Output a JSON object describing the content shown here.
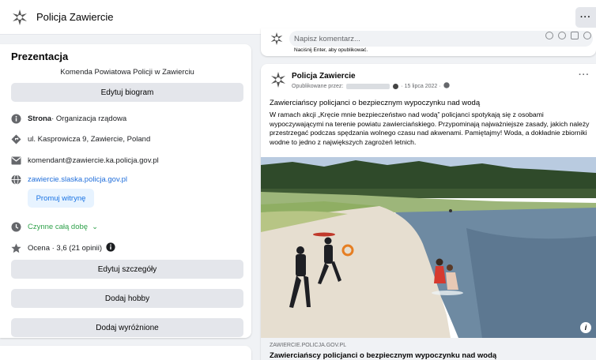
{
  "page": {
    "name": "Policja Zawiercie",
    "more_label": "···"
  },
  "intro": {
    "title": "Prezentacja",
    "bio": "Komenda Powiatowa Policji w Zawierciu",
    "edit_bio_label": "Edytuj biogram",
    "category_prefix": "Strona",
    "category": " · Organizacja rządowa",
    "address": "ul. Kasprowicza 9, Zawiercie, Poland",
    "email": "komendant@zawiercie.ka.policja.gov.pl",
    "website": "zawiercie.slaska.policja.gov.pl",
    "promote_label": "Promuj witrynę",
    "hours": "Czynne całą dobę",
    "hours_chevron": "⌄",
    "rating": "Ocena · 3,6 (21 opinii)",
    "edit_details_label": "Edytuj szczegóły",
    "add_hobby_label": "Dodaj hobby",
    "add_featured_label": "Dodaj wyróżnione"
  },
  "comment": {
    "placeholder": "Napisz komentarz...",
    "hint": "Naciśnij Enter, aby opublikować."
  },
  "post": {
    "author": "Policja Zawiercie",
    "published_by": "Opublikowane przez:",
    "date": "· 15 lipca 2022 ·",
    "more_label": "···",
    "headline": "Zawierciańscy policjanci o bezpiecznym wypoczynku nad wodą",
    "body": "W ramach akcji „Kręcie mnie bezpieczeństwo nad wodą” policjanci spotykają się z osobami wypoczywającymi na terenie powiatu zawierciańskiego. Przypominają najważniejsze zasady, jakich należy przestrzegać podczas spędzania wolnego czasu nad akwenami. Pamiętajmy! Woda, a dokładnie zbiorniki wodne to jedno z największych zagrożeń letnich.",
    "info_icon": "i",
    "link_domain": "ZAWIERCIE.POLICJA.GOV.PL",
    "link_title": "Zawierciańscy policjanci o bezpiecznym wypoczynku nad wodą"
  },
  "colors": {
    "accent_blue": "#216fdb",
    "green_open": "#31a24c",
    "button_gray": "#e4e6eb",
    "background": "#f0f2f5"
  },
  "icons": [
    "police-star-logo",
    "info-icon",
    "diamond-location-icon",
    "mail-icon",
    "globe-icon",
    "clock-icon",
    "star-icon",
    "globe-small-icon",
    "emoji-icon",
    "camera-icon",
    "gif-icon",
    "sticker-icon"
  ]
}
